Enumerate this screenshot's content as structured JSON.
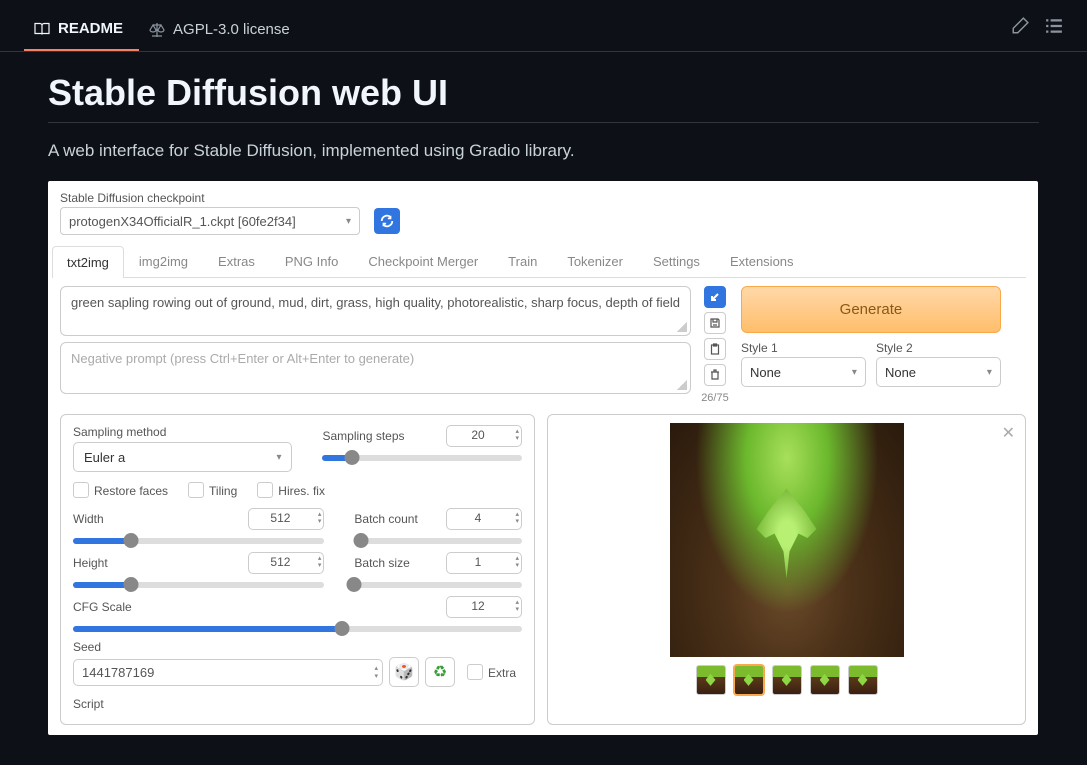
{
  "gh": {
    "tabs": [
      {
        "label": "README",
        "active": true
      },
      {
        "label": "AGPL-3.0 license",
        "active": false
      }
    ]
  },
  "title": "Stable Diffusion web UI",
  "subtitle": "A web interface for Stable Diffusion, implemented using Gradio library.",
  "sd": {
    "checkpoint_label": "Stable Diffusion checkpoint",
    "checkpoint_value": "protogenX34OfficialR_1.ckpt [60fe2f34]",
    "tabs": [
      "txt2img",
      "img2img",
      "Extras",
      "PNG Info",
      "Checkpoint Merger",
      "Train",
      "Tokenizer",
      "Settings",
      "Extensions"
    ],
    "active_tab": "txt2img",
    "prompt": "green sapling rowing out of ground, mud, dirt, grass, high quality, photorealistic, sharp focus, depth of field",
    "negative_placeholder": "Negative prompt (press Ctrl+Enter or Alt+Enter to generate)",
    "token_count": "26/75",
    "generate_label": "Generate",
    "style1_label": "Style 1",
    "style2_label": "Style 2",
    "style_none": "None",
    "params": {
      "sampling_method_label": "Sampling method",
      "sampling_method_value": "Euler a",
      "sampling_steps_label": "Sampling steps",
      "sampling_steps_value": "20",
      "restore_faces": "Restore faces",
      "tiling": "Tiling",
      "hires_fix": "Hires. fix",
      "width_label": "Width",
      "width_value": "512",
      "height_label": "Height",
      "height_value": "512",
      "batch_count_label": "Batch count",
      "batch_count_value": "4",
      "batch_size_label": "Batch size",
      "batch_size_value": "1",
      "cfg_label": "CFG Scale",
      "cfg_value": "12",
      "seed_label": "Seed",
      "seed_value": "1441787169",
      "extra_label": "Extra",
      "script_label": "Script"
    }
  }
}
